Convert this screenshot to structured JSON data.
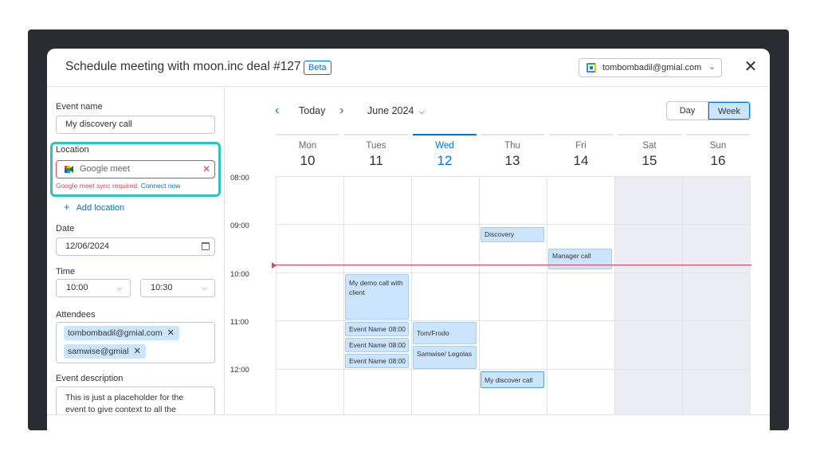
{
  "header": {
    "title": "Schedule meeting with moon.inc deal #127",
    "badge": "Beta",
    "account": "tombombadil@gmial.com",
    "account_icon": "google-calendar-icon",
    "close_icon": "✕"
  },
  "form": {
    "event_name_label": "Event name",
    "event_name_value": "My discovery call",
    "location_label": "Location",
    "location_value": "Google meet",
    "location_icon": "google-meet-icon",
    "location_error": "Google meet sync required.",
    "location_error_link": "Connect now",
    "add_location": "Add location",
    "date_label": "Date",
    "date_value": "12/06/2024",
    "time_label": "Time",
    "time_start": "10:00",
    "time_end": "10:30",
    "attendees_label": "Attendees",
    "attendees": [
      "tombombadil@gmial.com",
      "samwise@gmial"
    ],
    "description_label": "Event description",
    "description_value": "This is just a placeholder for the event to give context to all the"
  },
  "calendar": {
    "today_label": "Today",
    "month_label": "June 2024",
    "view_day": "Day",
    "view_week": "Week",
    "active_view": "Week",
    "days": [
      {
        "name": "Mon",
        "date": "10"
      },
      {
        "name": "Tues",
        "date": "11"
      },
      {
        "name": "Wed",
        "date": "12",
        "today": true
      },
      {
        "name": "Thu",
        "date": "13"
      },
      {
        "name": "Fri",
        "date": "14"
      },
      {
        "name": "Sat",
        "date": "15",
        "weekend": true
      },
      {
        "name": "Sun",
        "date": "16",
        "weekend": true
      }
    ],
    "times": [
      "08:00",
      "09:00",
      "10:00",
      "11:00",
      "12:00"
    ],
    "events": [
      {
        "title": "Discovery",
        "day": "Thu",
        "start": "09:00"
      },
      {
        "title": "Manager call",
        "day": "Fri",
        "start": "09:30"
      },
      {
        "title": "My demo call with client",
        "day": "Tues",
        "start": "10:00"
      },
      {
        "title": "Event Name",
        "time": "08:00",
        "day": "Tues",
        "start": "11:00"
      },
      {
        "title": "Event Name",
        "time": "08:00",
        "day": "Tues",
        "start": "11:20"
      },
      {
        "title": "Event Name",
        "time": "08:00",
        "day": "Tues",
        "start": "11:40"
      },
      {
        "title": "Tom/Frodo",
        "day": "Wed",
        "start": "11:00"
      },
      {
        "title": "Samwise/ Legolas",
        "day": "Wed",
        "start": "11:30"
      },
      {
        "title": "My discover call",
        "day": "Thu",
        "start": "12:00"
      }
    ]
  }
}
